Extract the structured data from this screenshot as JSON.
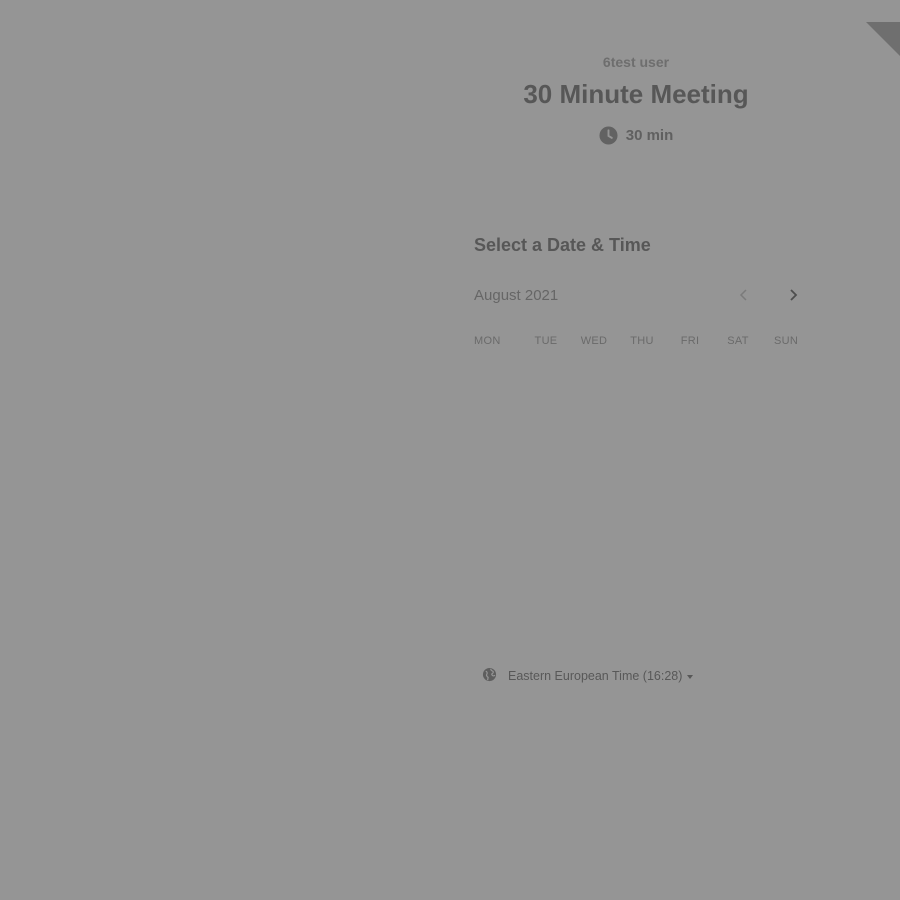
{
  "header": {
    "host_name": "6test user",
    "event_title": "30 Minute Meeting",
    "duration": "30 min",
    "duration_icon": "clock-icon"
  },
  "scheduler": {
    "section_title": "Select a Date & Time",
    "month_label": "August 2021",
    "prev_icon": "chevron-left-icon",
    "next_icon": "chevron-right-icon",
    "weekdays": [
      "MON",
      "TUE",
      "WED",
      "THU",
      "FRI",
      "SAT",
      "SUN"
    ]
  },
  "timezone": {
    "label": "Eastern European Time (16:28)",
    "icon": "globe-icon"
  },
  "colors": {
    "overlay_background": "#959595",
    "text_dark": "#575757",
    "text_muted": "#6e6e6e",
    "corner_ribbon": "#6f6f6f"
  }
}
